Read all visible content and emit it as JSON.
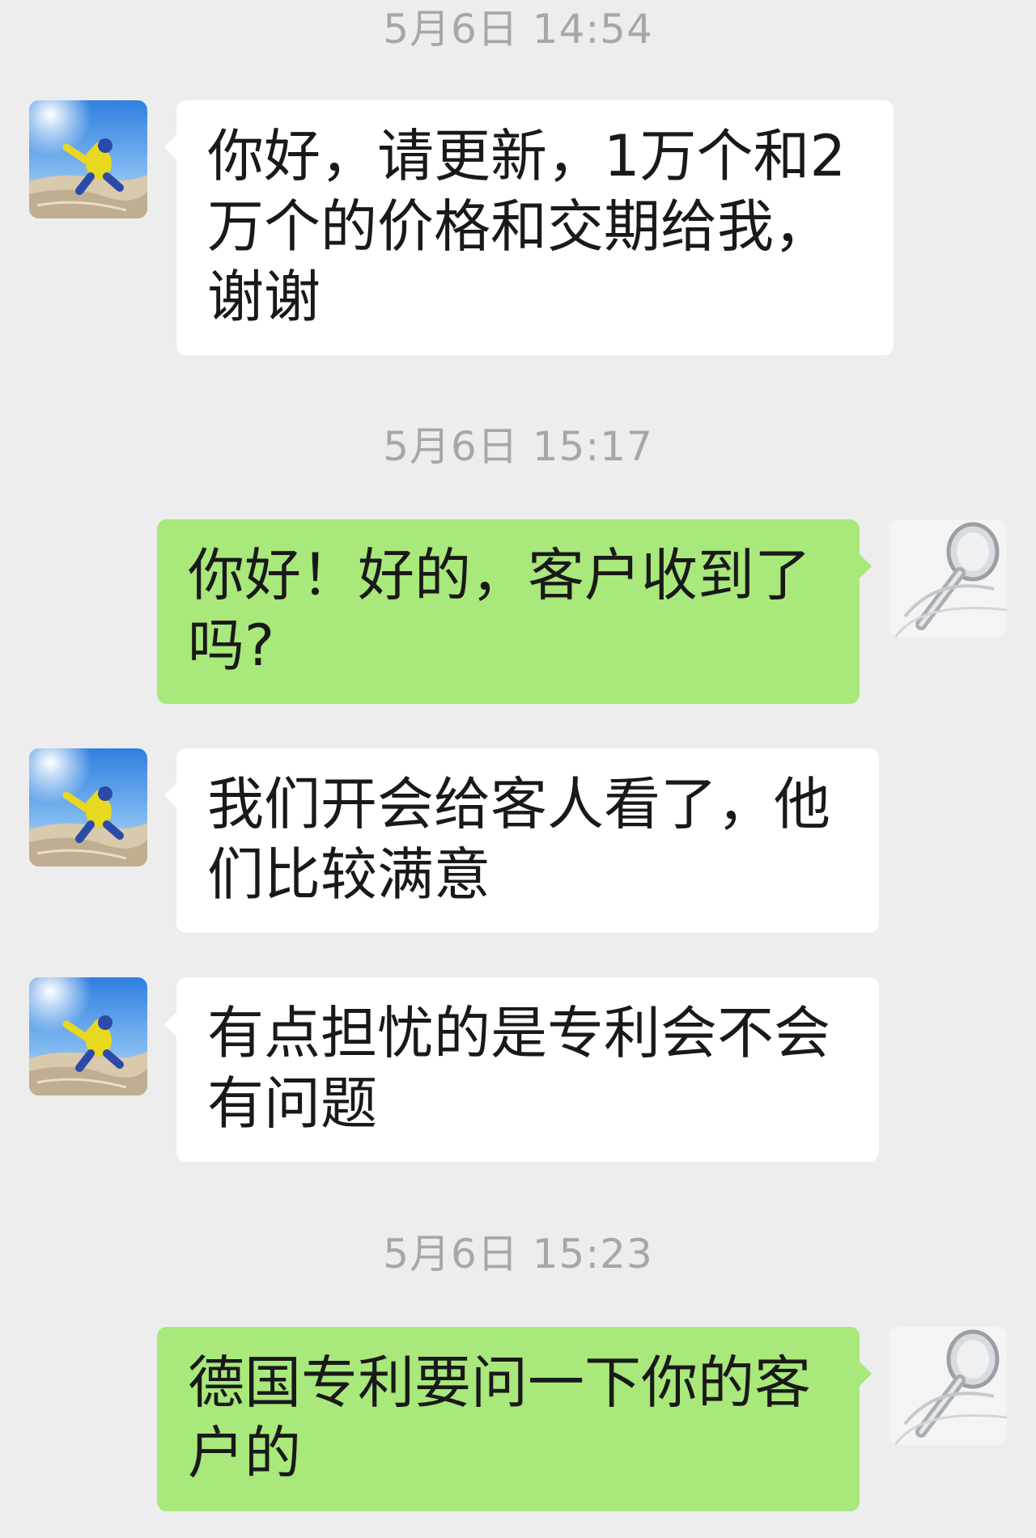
{
  "chat": {
    "messages": [
      {
        "kind": "timestamp",
        "text": "5月6日 14:54"
      },
      {
        "kind": "message",
        "side": "incoming",
        "avatar": "person-jumping-desert-avatar",
        "text": "你好，请更新，1万个和2万个的价格和交期给我，谢谢"
      },
      {
        "kind": "timestamp",
        "text": "5月6日 15:17"
      },
      {
        "kind": "message",
        "side": "outgoing",
        "avatar": "shower-head-avatar",
        "text": "你好！好的，客户收到了吗?"
      },
      {
        "kind": "message",
        "side": "incoming",
        "avatar": "person-jumping-desert-avatar",
        "text": "我们开会给客人看了，他们比较满意"
      },
      {
        "kind": "message",
        "side": "incoming",
        "avatar": "person-jumping-desert-avatar",
        "text": "有点担忧的是专利会不会有问题"
      },
      {
        "kind": "timestamp",
        "text": "5月6日 15:23"
      },
      {
        "kind": "message",
        "side": "outgoing",
        "avatar": "shower-head-avatar",
        "text": "德国专利要问一下你的客户的"
      }
    ]
  },
  "colors": {
    "background": "#ededed",
    "incoming_bubble": "#ffffff",
    "outgoing_bubble": "#a9e87b",
    "timestamp_text": "#a7a7a7",
    "message_text": "#191919"
  }
}
